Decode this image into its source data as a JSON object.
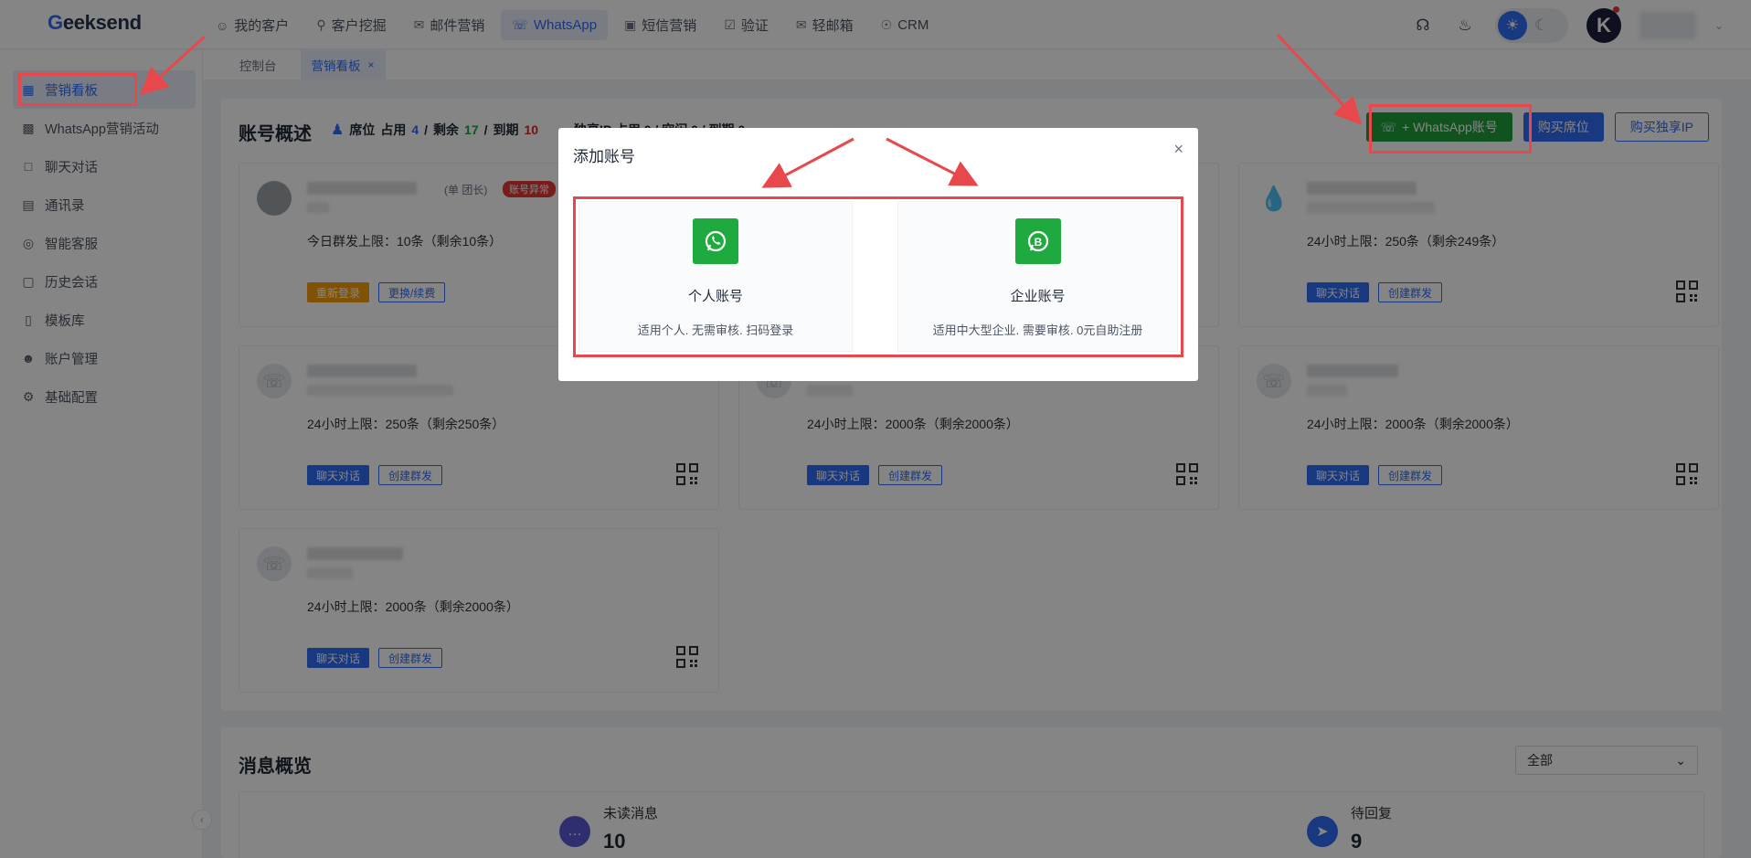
{
  "brand": {
    "logo_prefix": "G",
    "logo_text": "eeksend"
  },
  "nav": [
    {
      "label": "我的客户",
      "icon": "user-icon"
    },
    {
      "label": "客户挖掘",
      "icon": "search-icon"
    },
    {
      "label": "邮件营销",
      "icon": "mail-icon"
    },
    {
      "label": "WhatsApp",
      "icon": "whatsapp-icon"
    },
    {
      "label": "短信营销",
      "icon": "sms-icon"
    },
    {
      "label": "验证",
      "icon": "verify-icon"
    },
    {
      "label": "轻邮箱",
      "icon": "light-mail-icon"
    },
    {
      "label": "CRM",
      "icon": "crm-icon"
    }
  ],
  "avatar_letter": "K",
  "sidebar": [
    {
      "label": "营销看板",
      "icon": "dashboard-icon"
    },
    {
      "label": "WhatsApp营销活动",
      "icon": "campaign-icon"
    },
    {
      "label": "聊天对话",
      "icon": "chat-icon"
    },
    {
      "label": "通讯录",
      "icon": "contacts-icon"
    },
    {
      "label": "智能客服",
      "icon": "robot-icon"
    },
    {
      "label": "历史会话",
      "icon": "history-icon"
    },
    {
      "label": "模板库",
      "icon": "template-icon"
    },
    {
      "label": "账户管理",
      "icon": "account-icon"
    },
    {
      "label": "基础配置",
      "icon": "settings-icon"
    }
  ],
  "tabs": [
    {
      "label": "控制台"
    },
    {
      "label": "营销看板"
    }
  ],
  "overview": {
    "title": "账号概述",
    "seats_label": "席位",
    "used_label": "占用",
    "used": "4",
    "remaining_label": "剩余",
    "remaining": "17",
    "expired_label": "到期",
    "expired": "10",
    "ip_seats_text": "独享IP 占用 0 / 空闲 0 / 到期 0"
  },
  "buttons": {
    "add_whatsapp": "+ WhatsApp账号",
    "buy_seat": "购买席位",
    "buy_ip": "购买独享IP"
  },
  "cards": [
    {
      "role": "(单 团长)",
      "badge": "账号异常",
      "limit": "今日群发上限：10条（剩余10条）",
      "btn1": "重新登录",
      "btn2": "更换/续费"
    },
    {
      "limit": "24小时上限：250条（剩余249条）",
      "btn1": "聊天对话",
      "btn2": "创建群发"
    },
    {
      "limit": "24小时上限：250条（剩余250条）",
      "btn1": "聊天对话",
      "btn2": "创建群发"
    },
    {
      "limit": "24小时上限：2000条（剩余2000条）",
      "btn1": "聊天对话",
      "btn2": "创建群发"
    },
    {
      "limit": "24小时上限：2000条（剩余2000条）",
      "btn1": "聊天对话",
      "btn2": "创建群发"
    },
    {
      "limit": "24小时上限：2000条（剩余2000条）",
      "btn1": "聊天对话",
      "btn2": "创建群发"
    }
  ],
  "messages": {
    "title": "消息概览",
    "filter": "全部",
    "unread_label": "未读消息",
    "unread_value": "10",
    "pending_label": "待回复",
    "pending_value": "9"
  },
  "modal": {
    "title": "添加账号",
    "personal": {
      "name": "个人账号",
      "desc": "适用个人. 无需审核. 扫码登录"
    },
    "business": {
      "name": "企业账号",
      "desc": "适用中大型企业. 需要审核. 0元自助注册"
    }
  },
  "colors": {
    "primary": "#2f6bf5",
    "whatsapp_green": "#1faa3f",
    "highlight_red": "#e8484c"
  }
}
